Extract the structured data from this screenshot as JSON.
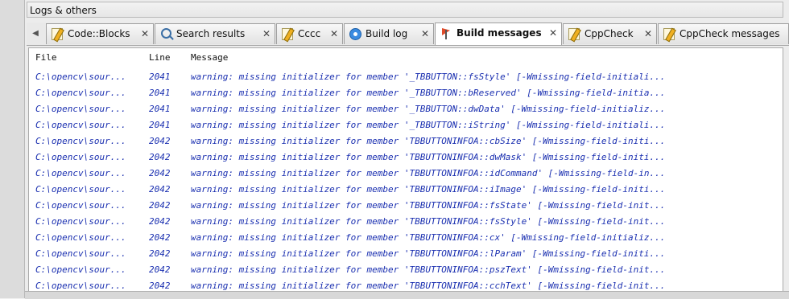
{
  "panel": {
    "title": "Logs & others"
  },
  "tabs": [
    {
      "label": "Code::Blocks",
      "icon": "pencil-doc-icon",
      "active": false
    },
    {
      "label": "Search results",
      "icon": "search-icon",
      "active": false
    },
    {
      "label": "Cccc",
      "icon": "pencil-doc-icon",
      "active": false
    },
    {
      "label": "Build log",
      "icon": "gear-icon",
      "active": false
    },
    {
      "label": "Build messages",
      "icon": "flag-icon",
      "active": true
    },
    {
      "label": "CppCheck",
      "icon": "pencil-doc-icon",
      "active": false
    },
    {
      "label": "CppCheck messages",
      "icon": "pencil-doc-icon",
      "active": false
    }
  ],
  "tab_close_glyph": "✕",
  "scroll_left_glyph": "◀",
  "columns": {
    "file": "File",
    "line": "Line",
    "message": "Message"
  },
  "messages": [
    {
      "file": "C:\\opencv\\sour...",
      "line": "2041",
      "message": "warning: missing initializer for member '_TBBUTTON::fsStyle' [-Wmissing-field-initiali..."
    },
    {
      "file": "C:\\opencv\\sour...",
      "line": "2041",
      "message": "warning: missing initializer for member '_TBBUTTON::bReserved' [-Wmissing-field-initia..."
    },
    {
      "file": "C:\\opencv\\sour...",
      "line": "2041",
      "message": "warning: missing initializer for member '_TBBUTTON::dwData' [-Wmissing-field-initializ..."
    },
    {
      "file": "C:\\opencv\\sour...",
      "line": "2041",
      "message": "warning: missing initializer for member '_TBBUTTON::iString' [-Wmissing-field-initiali..."
    },
    {
      "file": "C:\\opencv\\sour...",
      "line": "2042",
      "message": "warning: missing initializer for member 'TBBUTTONINFOA::cbSize' [-Wmissing-field-initi..."
    },
    {
      "file": "C:\\opencv\\sour...",
      "line": "2042",
      "message": "warning: missing initializer for member 'TBBUTTONINFOA::dwMask' [-Wmissing-field-initi..."
    },
    {
      "file": "C:\\opencv\\sour...",
      "line": "2042",
      "message": "warning: missing initializer for member 'TBBUTTONINFOA::idCommand' [-Wmissing-field-in..."
    },
    {
      "file": "C:\\opencv\\sour...",
      "line": "2042",
      "message": "warning: missing initializer for member 'TBBUTTONINFOA::iImage' [-Wmissing-field-initi..."
    },
    {
      "file": "C:\\opencv\\sour...",
      "line": "2042",
      "message": "warning: missing initializer for member 'TBBUTTONINFOA::fsState' [-Wmissing-field-init..."
    },
    {
      "file": "C:\\opencv\\sour...",
      "line": "2042",
      "message": "warning: missing initializer for member 'TBBUTTONINFOA::fsStyle' [-Wmissing-field-init..."
    },
    {
      "file": "C:\\opencv\\sour...",
      "line": "2042",
      "message": "warning: missing initializer for member 'TBBUTTONINFOA::cx' [-Wmissing-field-initializ..."
    },
    {
      "file": "C:\\opencv\\sour...",
      "line": "2042",
      "message": "warning: missing initializer for member 'TBBUTTONINFOA::lParam' [-Wmissing-field-initi..."
    },
    {
      "file": "C:\\opencv\\sour...",
      "line": "2042",
      "message": "warning: missing initializer for member 'TBBUTTONINFOA::pszText' [-Wmissing-field-init..."
    },
    {
      "file": "C:\\opencv\\sour...",
      "line": "2042",
      "message": "warning: missing initializer for member 'TBBUTTONINFOA::cchText' [-Wmissing-field-init..."
    }
  ],
  "colors": {
    "message_text": "#1a2fb0",
    "active_tab": "#ffffff"
  }
}
